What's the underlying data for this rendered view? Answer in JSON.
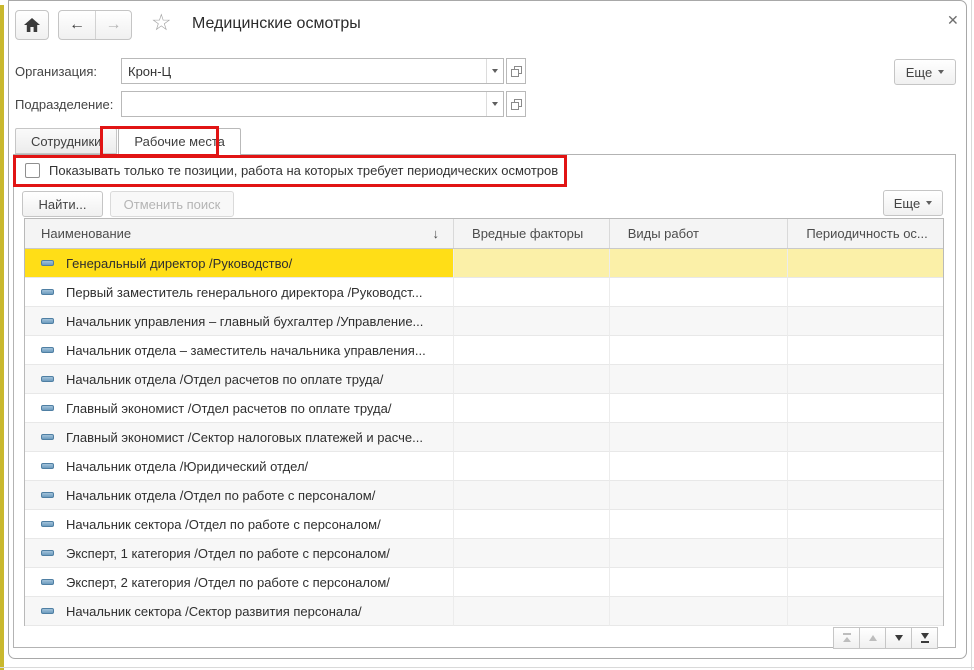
{
  "window": {
    "title": "Медицинские осмотры"
  },
  "header": {
    "more_label": "Еще",
    "back_enabled": true,
    "forward_enabled": false
  },
  "fields": {
    "organization": {
      "label": "Организация:",
      "value": "Крон-Ц"
    },
    "department": {
      "label": "Подразделение:",
      "value": ""
    }
  },
  "tabs": [
    {
      "label": "Сотрудники",
      "active": false
    },
    {
      "label": "Рабочие места",
      "active": true
    }
  ],
  "filter": {
    "checkbox_label": "Показывать только те позиции, работа на которых требует периодических осмотров",
    "checked": false
  },
  "list_toolbar": {
    "find_label": "Найти...",
    "cancel_search_label": "Отменить поиск",
    "cancel_search_enabled": false,
    "more_label": "Еще"
  },
  "table": {
    "columns": [
      "Наименование",
      "Вредные факторы",
      "Виды работ",
      "Периодичность ос..."
    ],
    "sort_column": "Наименование",
    "selected_index": 0,
    "rows": [
      {
        "name": "Генеральный директор /Руководство/",
        "harmful_factors": "",
        "work_types": "",
        "periodicity": ""
      },
      {
        "name": "Первый заместитель генерального директора /Руководст...",
        "harmful_factors": "",
        "work_types": "",
        "periodicity": ""
      },
      {
        "name": "Начальник управления – главный бухгалтер /Управление...",
        "harmful_factors": "",
        "work_types": "",
        "periodicity": ""
      },
      {
        "name": "Начальник отдела – заместитель начальника управления...",
        "harmful_factors": "",
        "work_types": "",
        "periodicity": ""
      },
      {
        "name": "Начальник отдела /Отдел расчетов по оплате труда/",
        "harmful_factors": "",
        "work_types": "",
        "periodicity": ""
      },
      {
        "name": "Главный экономист /Отдел расчетов по оплате труда/",
        "harmful_factors": "",
        "work_types": "",
        "periodicity": ""
      },
      {
        "name": "Главный экономист /Сектор налоговых платежей и расче...",
        "harmful_factors": "",
        "work_types": "",
        "periodicity": ""
      },
      {
        "name": "Начальник отдела /Юридический отдел/",
        "harmful_factors": "",
        "work_types": "",
        "periodicity": ""
      },
      {
        "name": "Начальник отдела /Отдел по работе с персоналом/",
        "harmful_factors": "",
        "work_types": "",
        "periodicity": ""
      },
      {
        "name": "Начальник сектора /Отдел по работе с персоналом/",
        "harmful_factors": "",
        "work_types": "",
        "periodicity": ""
      },
      {
        "name": "Эксперт, 1 категория /Отдел по работе с персоналом/",
        "harmful_factors": "",
        "work_types": "",
        "periodicity": ""
      },
      {
        "name": "Эксперт, 2 категория /Отдел по работе с персоналом/",
        "harmful_factors": "",
        "work_types": "",
        "periodicity": ""
      },
      {
        "name": "Начальник сектора /Сектор развития персонала/",
        "harmful_factors": "",
        "work_types": "",
        "periodicity": ""
      }
    ]
  },
  "pager": {
    "first_enabled": false,
    "up_enabled": false,
    "down_enabled": true,
    "last_enabled": true
  },
  "icons": {
    "home": "house",
    "back": "←",
    "forward": "→",
    "favorite": "☆",
    "close": "✕",
    "dropdown": "chevron-down",
    "sort_desc": "↓",
    "row_marker": "position-dash",
    "open_form": "overlapping-squares"
  },
  "colors": {
    "selection_current_cell": "#ffde17",
    "selection_row": "#fbf0a8",
    "annotation_red": "#e11414",
    "left_strip_yellow": "#c9b82e",
    "header_bg": "#f4f4f4"
  }
}
